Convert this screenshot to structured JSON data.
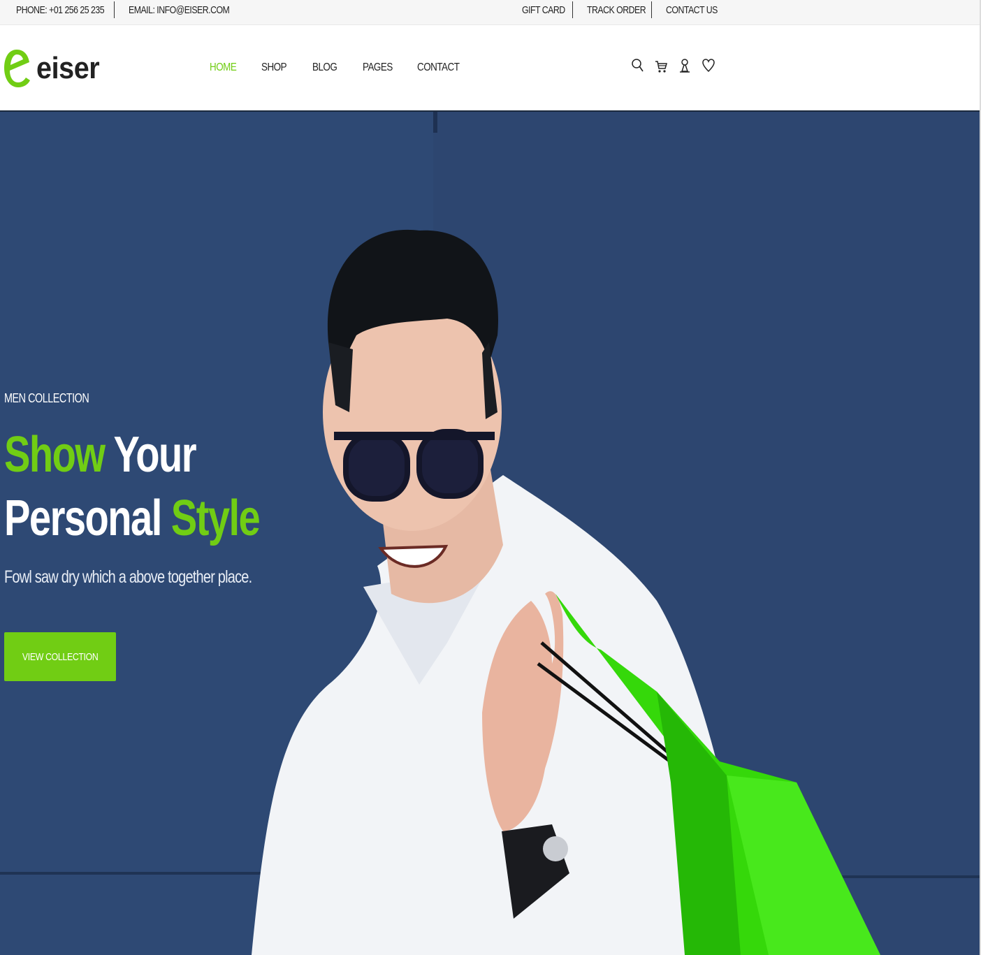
{
  "topbar": {
    "phone": "PHONE: +01 256 25 235",
    "email": "EMAIL: INFO@EISER.COM",
    "links": [
      "GIFT CARD",
      "TRACK ORDER",
      "CONTACT US"
    ]
  },
  "header": {
    "brand": "eiser",
    "nav": [
      "HOME",
      "SHOP",
      "BLOG",
      "PAGES",
      "CONTACT"
    ],
    "active_nav": "HOME",
    "icons": [
      "search-icon",
      "cart-icon",
      "user-icon",
      "heart-icon"
    ]
  },
  "hero": {
    "kicker": "MEN COLLECTION",
    "title_line1_a": "Show",
    "title_line1_b": "Your",
    "title_line2_a": "Personal",
    "title_line2_b": "Style",
    "subtitle": "Fowl saw dry which a above together place.",
    "cta": "VIEW COLLECTION",
    "image_description": "smiling man in sunglasses and white shirt holding a green shopping bag"
  },
  "colors": {
    "accent": "#71cd14",
    "hero_bg": "#2d4670",
    "text": "#222222"
  }
}
